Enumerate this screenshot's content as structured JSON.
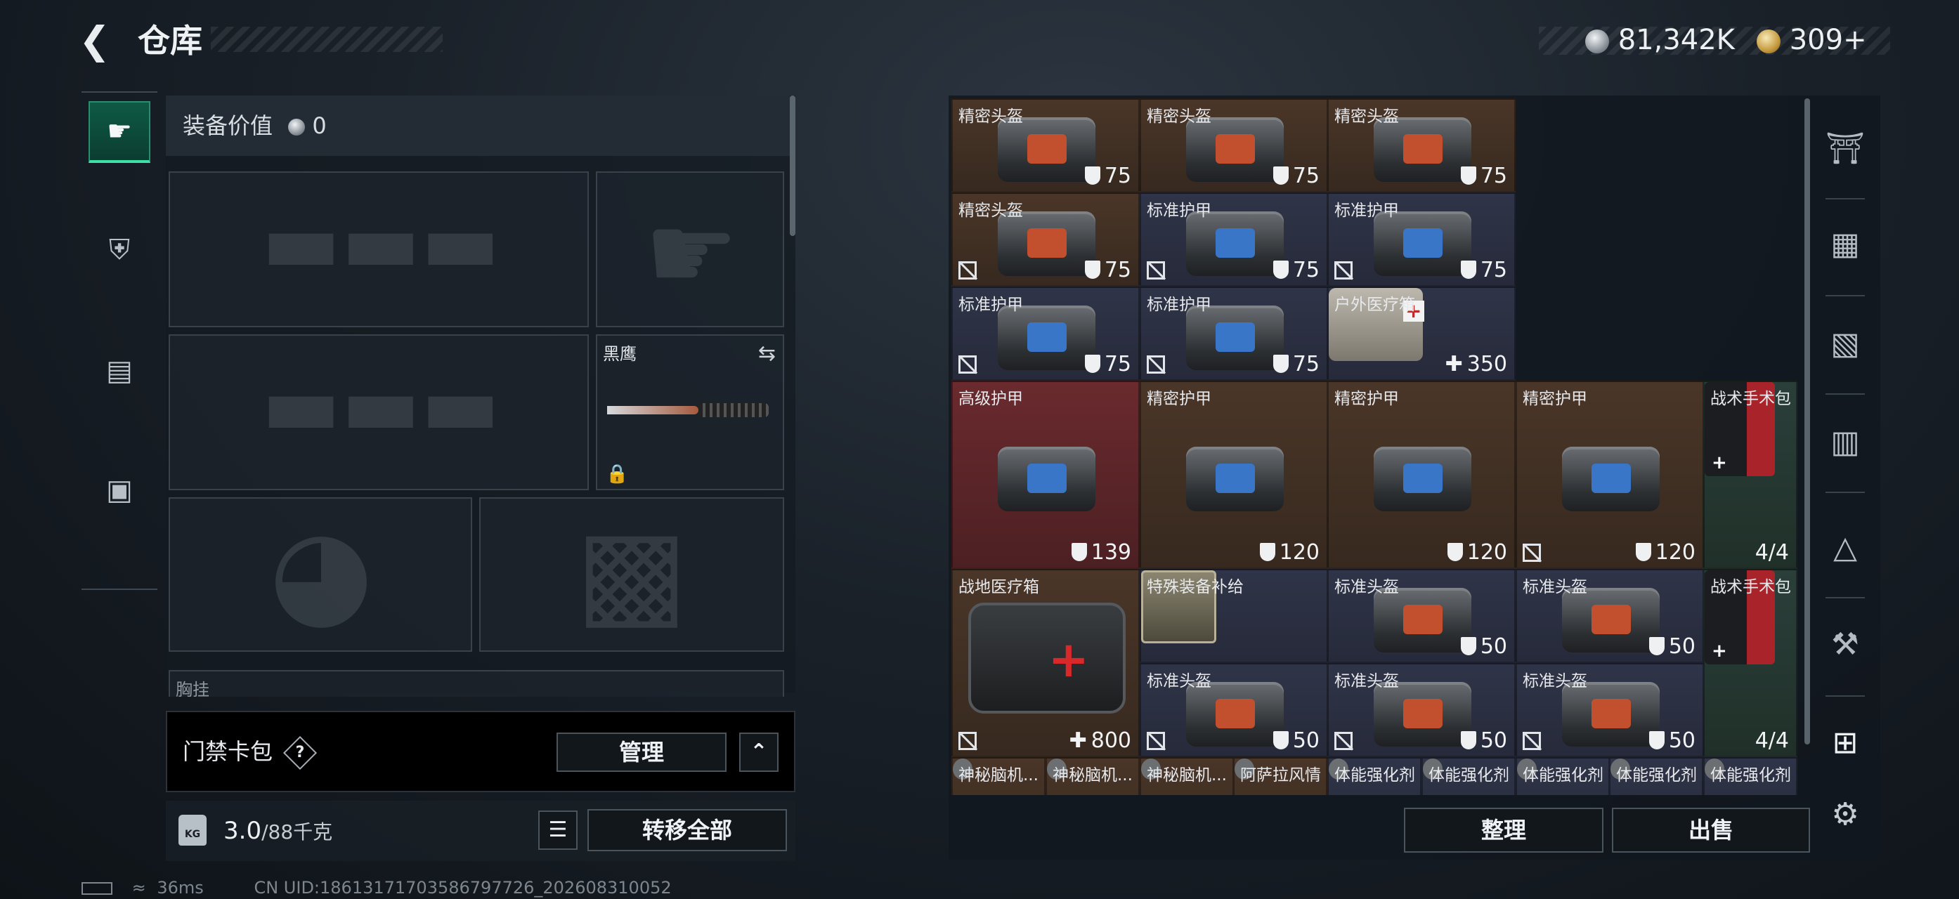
{
  "header": {
    "back_icon": "chevron-left-icon",
    "title": "仓库"
  },
  "currency": {
    "silver": "81,342K",
    "gold": "309+"
  },
  "equipment": {
    "value_label": "装备价值",
    "value": "0",
    "knife_label": "黑鹰",
    "chest_label": "胸挂"
  },
  "card_pack": {
    "label": "门禁卡包",
    "help": "?",
    "manage": "管理"
  },
  "weight": {
    "current": "3.0",
    "max": "/88千克",
    "transfer": "转移全部"
  },
  "inventory": {
    "cells": [
      {
        "name": "精密头盔",
        "value": "75",
        "kind": "shield"
      },
      {
        "name": "精密头盔",
        "value": "75",
        "kind": "shield"
      },
      {
        "name": "精密头盔",
        "value": "75",
        "kind": "shield"
      },
      {
        "name": "精密头盔",
        "value": "75",
        "kind": "shield"
      },
      {
        "name": "标准护甲",
        "value": "75",
        "kind": "shield"
      },
      {
        "name": "标准护甲",
        "value": "75",
        "kind": "shield"
      },
      {
        "name": "标准护甲",
        "value": "75",
        "kind": "shield"
      },
      {
        "name": "标准护甲",
        "value": "75",
        "kind": "shield"
      },
      {
        "name": "户外医疗箱",
        "value": "350",
        "kind": "heal"
      },
      {
        "name": "高级护甲",
        "value": "139",
        "kind": "shield"
      },
      {
        "name": "精密护甲",
        "value": "120",
        "kind": "shield"
      },
      {
        "name": "精密护甲",
        "value": "120",
        "kind": "shield"
      },
      {
        "name": "精密护甲",
        "value": "120",
        "kind": "shield"
      },
      {
        "name": "战术手术包",
        "value": "4/4",
        "kind": "count"
      },
      {
        "name": "战地医疗箱",
        "value": "800",
        "kind": "heal"
      },
      {
        "name": "特殊装备补给",
        "value": "",
        "kind": "none"
      },
      {
        "name": "标准头盔",
        "value": "50",
        "kind": "shield"
      },
      {
        "name": "标准头盔",
        "value": "50",
        "kind": "shield"
      },
      {
        "name": "战术手术包",
        "value": "4/4",
        "kind": "count"
      },
      {
        "name": "标准头盔",
        "value": "50",
        "kind": "shield"
      },
      {
        "name": "标准头盔",
        "value": "50",
        "kind": "shield"
      },
      {
        "name": "标准头盔",
        "value": "50",
        "kind": "shield"
      },
      {
        "name": "神秘脑机...",
        "value": "",
        "kind": "none"
      },
      {
        "name": "神秘脑机...",
        "value": "",
        "kind": "none"
      },
      {
        "name": "神秘脑机...",
        "value": "",
        "kind": "none"
      },
      {
        "name": "阿萨拉风情",
        "value": "",
        "kind": "none"
      },
      {
        "name": "体能强化剂",
        "value": "",
        "kind": "none"
      },
      {
        "name": "体能强化剂",
        "value": "",
        "kind": "none"
      },
      {
        "name": "体能强化剂",
        "value": "",
        "kind": "none"
      },
      {
        "name": "体能强化剂",
        "value": "",
        "kind": "none"
      },
      {
        "name": "体能强化剂",
        "value": "",
        "kind": "none"
      }
    ],
    "sort": "整理",
    "sell": "出售"
  },
  "status": {
    "latency": "36ms",
    "uid": "CN UID:18613171703586797726_202608310052"
  }
}
